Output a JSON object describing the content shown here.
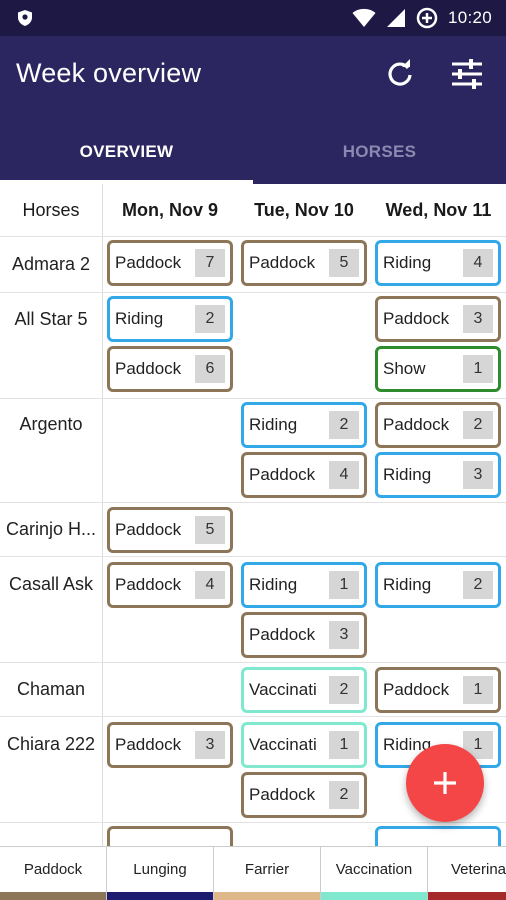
{
  "status_bar": {
    "time": "10:20"
  },
  "app_bar": {
    "title": "Week overview",
    "tabs": [
      {
        "label": "OVERVIEW",
        "active": true
      },
      {
        "label": "HORSES",
        "active": false
      }
    ]
  },
  "grid": {
    "horses_header": "Horses",
    "days": [
      "Mon, Nov 9",
      "Tue, Nov 10",
      "Wed, Nov 11"
    ],
    "horses": [
      {
        "name": "Admara 2"
      },
      {
        "name": "All Star 5"
      },
      {
        "name": "Argento"
      },
      {
        "name": "Carinjo H..."
      },
      {
        "name": "Casall Ask"
      },
      {
        "name": "Chaman"
      },
      {
        "name": "Chiara 222"
      }
    ],
    "activities": [
      {
        "horse": "Admara 2",
        "day": "Mon, Nov 9",
        "label": "Paddock",
        "count": "7",
        "type": "paddock"
      },
      {
        "horse": "Admara 2",
        "day": "Tue, Nov 10",
        "label": "Paddock",
        "count": "5",
        "type": "paddock"
      },
      {
        "horse": "Admara 2",
        "day": "Wed, Nov 11",
        "label": "Riding",
        "count": "4",
        "type": "riding"
      },
      {
        "horse": "All Star 5",
        "day": "Mon, Nov 9",
        "label": "Riding",
        "count": "2",
        "type": "riding"
      },
      {
        "horse": "All Star 5",
        "day": "Mon, Nov 9",
        "label": "Paddock",
        "count": "6",
        "type": "paddock"
      },
      {
        "horse": "All Star 5",
        "day": "Wed, Nov 11",
        "label": "Paddock",
        "count": "3",
        "type": "paddock"
      },
      {
        "horse": "All Star 5",
        "day": "Wed, Nov 11",
        "label": "Show",
        "count": "1",
        "type": "show"
      },
      {
        "horse": "Argento",
        "day": "Tue, Nov 10",
        "label": "Riding",
        "count": "2",
        "type": "riding"
      },
      {
        "horse": "Argento",
        "day": "Tue, Nov 10",
        "label": "Paddock",
        "count": "4",
        "type": "paddock"
      },
      {
        "horse": "Argento",
        "day": "Wed, Nov 11",
        "label": "Paddock",
        "count": "2",
        "type": "paddock"
      },
      {
        "horse": "Argento",
        "day": "Wed, Nov 11",
        "label": "Riding",
        "count": "3",
        "type": "riding"
      },
      {
        "horse": "Carinjo H...",
        "day": "Mon, Nov 9",
        "label": "Paddock",
        "count": "5",
        "type": "paddock"
      },
      {
        "horse": "Casall Ask",
        "day": "Mon, Nov 9",
        "label": "Paddock",
        "count": "4",
        "type": "paddock"
      },
      {
        "horse": "Casall Ask",
        "day": "Tue, Nov 10",
        "label": "Riding",
        "count": "1",
        "type": "riding"
      },
      {
        "horse": "Casall Ask",
        "day": "Tue, Nov 10",
        "label": "Paddock",
        "count": "3",
        "type": "paddock"
      },
      {
        "horse": "Casall Ask",
        "day": "Wed, Nov 11",
        "label": "Riding",
        "count": "2",
        "type": "riding"
      },
      {
        "horse": "Chaman",
        "day": "Tue, Nov 10",
        "label": "Vaccinati",
        "count": "2",
        "type": "vacc"
      },
      {
        "horse": "Chaman",
        "day": "Wed, Nov 11",
        "label": "Paddock",
        "count": "1",
        "type": "paddock"
      },
      {
        "horse": "Chiara 222",
        "day": "Mon, Nov 9",
        "label": "Paddock",
        "count": "3",
        "type": "paddock"
      },
      {
        "horse": "Chiara 222",
        "day": "Tue, Nov 10",
        "label": "Vaccinati",
        "count": "1",
        "type": "vacc"
      },
      {
        "horse": "Chiara 222",
        "day": "Tue, Nov 10",
        "label": "Paddock",
        "count": "2",
        "type": "paddock"
      },
      {
        "horse": "Chiara 222",
        "day": "Wed, Nov 11",
        "label": "Riding",
        "count": "1",
        "type": "riding"
      }
    ]
  },
  "fab": {
    "symbol": "+"
  },
  "legend": [
    {
      "label": "Paddock",
      "color": "#8d7657"
    },
    {
      "label": "Lunging",
      "color": "#1d1c6e"
    },
    {
      "label": "Farrier",
      "color": "#dfb88a"
    },
    {
      "label": "Vaccination",
      "color": "#7fe8cf"
    },
    {
      "label": "Veterinar",
      "color": "#a52a2a"
    }
  ],
  "colors": {
    "status_bar": "#1d1944",
    "app_bar": "#2c2660",
    "paddock": "#8d7657",
    "riding": "#33a8e8",
    "show": "#2e8b2e",
    "vaccination": "#7fe8cf",
    "fab": "#f44646"
  },
  "icons": [
    "shield-icon",
    "wifi-icon",
    "signal-icon",
    "data-saver-icon",
    "refresh-icon",
    "filter-icon",
    "plus-icon"
  ]
}
